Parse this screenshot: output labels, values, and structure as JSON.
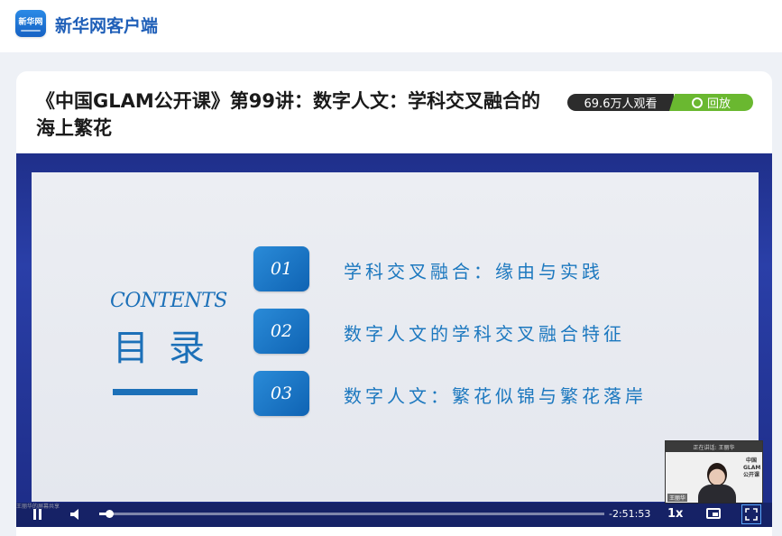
{
  "app": {
    "logo_text": "新华网",
    "name": "新华网客户端"
  },
  "live": {
    "title": "《中国GLAM公开课》第99讲：数字人文：学科交叉融合的海上繁花",
    "viewers": "69.6万人观看",
    "status": "回放"
  },
  "slide": {
    "contents_label": "CONTENTS",
    "toc_title": "目录",
    "items": [
      {
        "num": "01",
        "text": "学科交叉融合：缘由与实践"
      },
      {
        "num": "02",
        "text": "数字人文的学科交叉融合特征"
      },
      {
        "num": "03",
        "text": "数字人文：繁花似锦与繁花落岸"
      }
    ]
  },
  "pip": {
    "top_text": "正在讲话: 王丽华",
    "side_text": "中国GLAM公开课",
    "name_label": "王丽华"
  },
  "player": {
    "watermark": "王丽华的屏幕共享",
    "time_remaining": "-2:51:53",
    "speed": "1x",
    "progress_fraction": 0.02
  },
  "colors": {
    "brand_blue": "#1f5fb8",
    "slide_blue": "#1c70b8",
    "replay_green": "#6ab830"
  }
}
